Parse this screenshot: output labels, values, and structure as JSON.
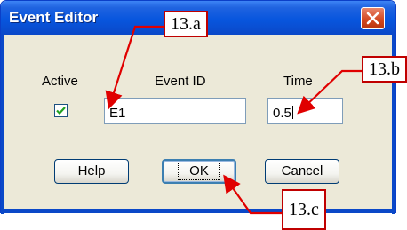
{
  "window": {
    "title": "Event Editor"
  },
  "labels": {
    "active": "Active",
    "event_id": "Event ID",
    "time": "Time"
  },
  "fields": {
    "event_id_value": "E1",
    "time_value": "0.5"
  },
  "checkbox": {
    "active_checked": true
  },
  "buttons": {
    "help": "Help",
    "ok": "OK",
    "cancel": "Cancel"
  },
  "annotations": {
    "a": "13.a",
    "b": "13.b",
    "c": "13.c"
  },
  "colors": {
    "titlebar": "#0856de",
    "dialog_bg": "#ece9d8",
    "callout_border": "#c00000",
    "close_button": "#d2461e",
    "checkmark": "#21a121"
  },
  "icons": {
    "close": "close-x-icon",
    "check": "checkmark-icon"
  }
}
